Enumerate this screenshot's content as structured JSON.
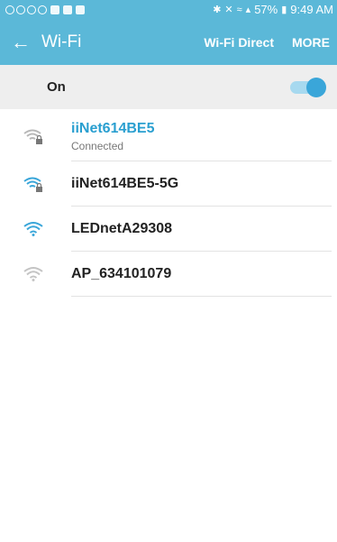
{
  "status_bar": {
    "battery": "57%",
    "time": "9:49 AM"
  },
  "app_bar": {
    "back_icon": "arrow-back-icon",
    "title": "Wi-Fi",
    "wifi_direct": "Wi-Fi Direct",
    "more": "MORE"
  },
  "toggle_row": {
    "label": "On",
    "state": "on"
  },
  "networks": [
    {
      "name": "iiNet614BE5",
      "status": "Connected",
      "secured": true,
      "signal": "weak"
    },
    {
      "name": "iiNet614BE5-5G",
      "status": "",
      "secured": true,
      "signal": "strong"
    },
    {
      "name": "LEDnetA29308",
      "status": "",
      "secured": false,
      "signal": "strong"
    },
    {
      "name": "AP_634101079",
      "status": "",
      "secured": false,
      "signal": "weak"
    }
  ],
  "colors": {
    "accent": "#5bb8d8",
    "connected_text": "#2a9fd0",
    "toggle_thumb": "#3aa6d9"
  }
}
